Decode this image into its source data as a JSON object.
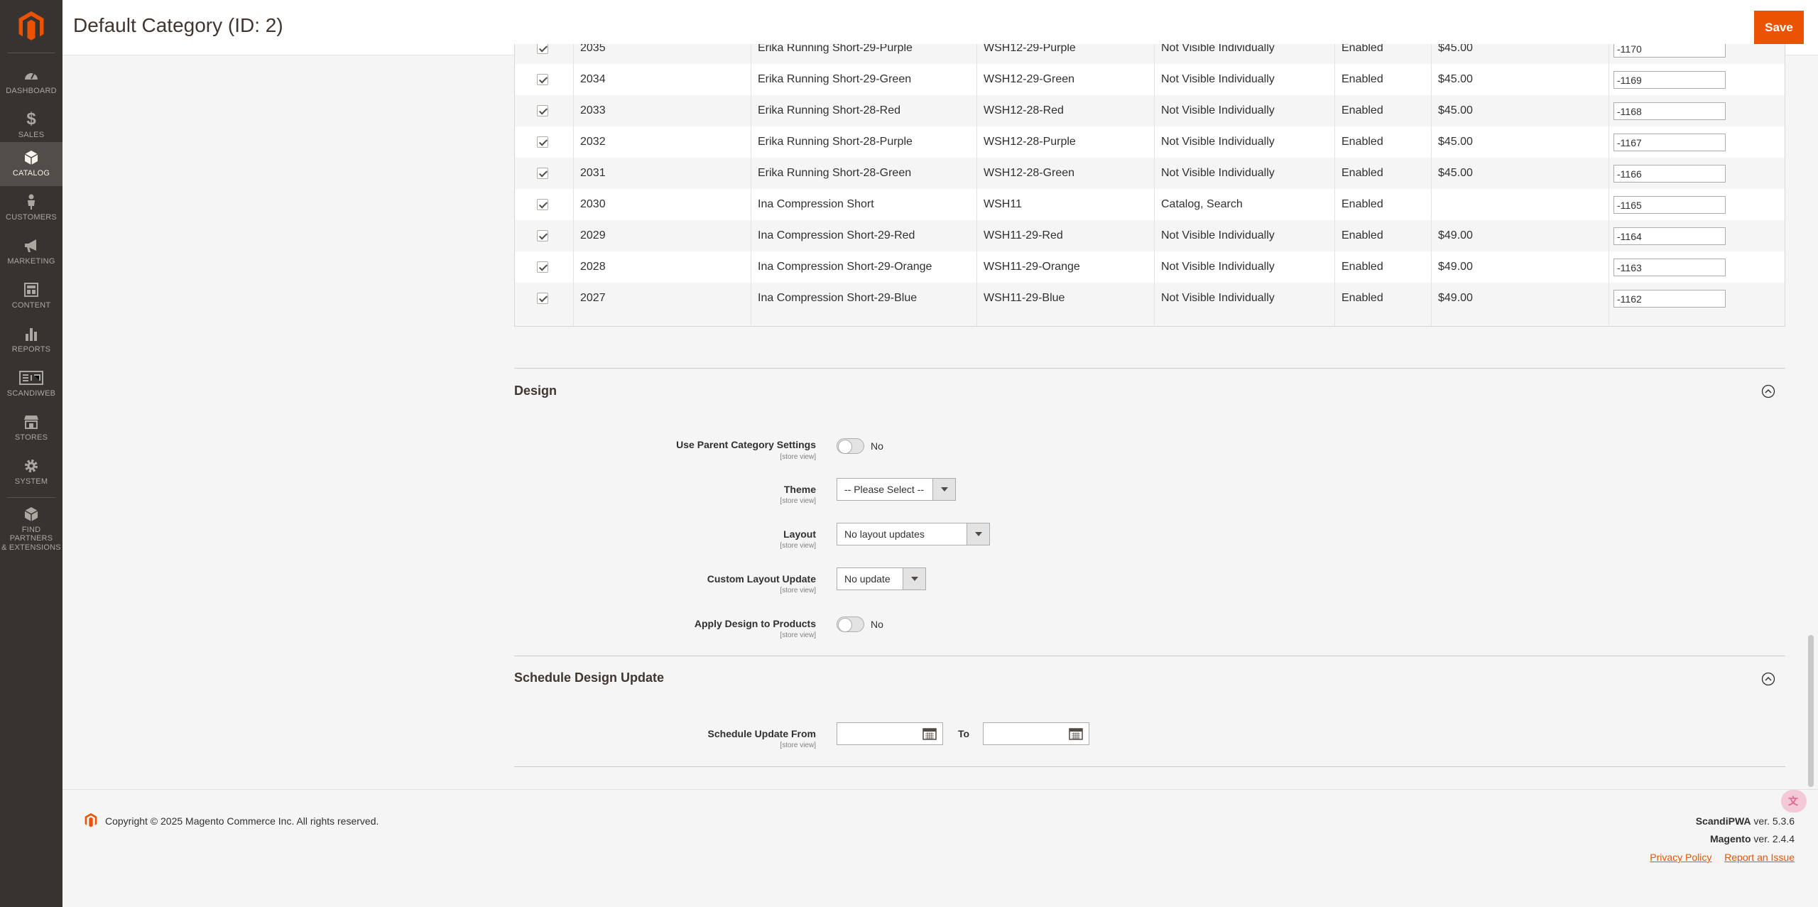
{
  "header": {
    "title": "Default Category (ID: 2)",
    "save_label": "Save"
  },
  "sidebar": {
    "items": [
      {
        "label": "DASHBOARD",
        "icon": "dashboard-icon"
      },
      {
        "label": "SALES",
        "icon": "dollar-icon"
      },
      {
        "label": "CATALOG",
        "icon": "box-icon",
        "active": true
      },
      {
        "label": "CUSTOMERS",
        "icon": "person-icon"
      },
      {
        "label": "MARKETING",
        "icon": "megaphone-icon"
      },
      {
        "label": "CONTENT",
        "icon": "layout-icon"
      },
      {
        "label": "REPORTS",
        "icon": "bar-chart-icon"
      },
      {
        "label": "SCANDIWEB",
        "icon": "scandiweb-icon"
      },
      {
        "label": "STORES",
        "icon": "store-icon"
      },
      {
        "label": "SYSTEM",
        "icon": "gear-icon"
      }
    ],
    "partners": {
      "line1": "FIND PARTNERS",
      "line2": "& EXTENSIONS"
    }
  },
  "grid": {
    "rows": [
      {
        "id": "2035",
        "name": "Erika Running Short-29-Purple",
        "sku": "WSH12-29-Purple",
        "visibility": "Not Visible Individually",
        "status": "Enabled",
        "price": "$45.00",
        "position": "-1170"
      },
      {
        "id": "2034",
        "name": "Erika Running Short-29-Green",
        "sku": "WSH12-29-Green",
        "visibility": "Not Visible Individually",
        "status": "Enabled",
        "price": "$45.00",
        "position": "-1169"
      },
      {
        "id": "2033",
        "name": "Erika Running Short-28-Red",
        "sku": "WSH12-28-Red",
        "visibility": "Not Visible Individually",
        "status": "Enabled",
        "price": "$45.00",
        "position": "-1168"
      },
      {
        "id": "2032",
        "name": "Erika Running Short-28-Purple",
        "sku": "WSH12-28-Purple",
        "visibility": "Not Visible Individually",
        "status": "Enabled",
        "price": "$45.00",
        "position": "-1167"
      },
      {
        "id": "2031",
        "name": "Erika Running Short-28-Green",
        "sku": "WSH12-28-Green",
        "visibility": "Not Visible Individually",
        "status": "Enabled",
        "price": "$45.00",
        "position": "-1166"
      },
      {
        "id": "2030",
        "name": "Ina Compression Short",
        "sku": "WSH11",
        "visibility": "Catalog, Search",
        "status": "Enabled",
        "price": "",
        "position": "-1165"
      },
      {
        "id": "2029",
        "name": "Ina Compression Short-29-Red",
        "sku": "WSH11-29-Red",
        "visibility": "Not Visible Individually",
        "status": "Enabled",
        "price": "$49.00",
        "position": "-1164"
      },
      {
        "id": "2028",
        "name": "Ina Compression Short-29-Orange",
        "sku": "WSH11-29-Orange",
        "visibility": "Not Visible Individually",
        "status": "Enabled",
        "price": "$49.00",
        "position": "-1163"
      },
      {
        "id": "2027",
        "name": "Ina Compression Short-29-Blue",
        "sku": "WSH11-29-Blue",
        "visibility": "Not Visible Individually",
        "status": "Enabled",
        "price": "$49.00",
        "position": "-1162"
      }
    ]
  },
  "design": {
    "title": "Design",
    "scope": "[store view]",
    "use_parent": {
      "label": "Use Parent Category Settings",
      "value": "No"
    },
    "theme": {
      "label": "Theme",
      "value": "-- Please Select --"
    },
    "layout": {
      "label": "Layout",
      "value": "No layout updates"
    },
    "custom_layout": {
      "label": "Custom Layout Update",
      "value": "No update"
    },
    "apply_design": {
      "label": "Apply Design to Products",
      "value": "No"
    }
  },
  "schedule": {
    "title": "Schedule Design Update",
    "from_label": "Schedule Update From",
    "to_label": "To",
    "scope": "[store view]"
  },
  "footer": {
    "copyright": "Copyright © 2025 Magento Commerce Inc. All rights reserved.",
    "scandipwa_name": "ScandiPWA",
    "scandipwa_ver": " ver. 5.3.6",
    "magento_name": "Magento",
    "magento_ver": " ver. 2.4.4",
    "privacy": "Privacy Policy",
    "report": "Report an Issue"
  },
  "colors": {
    "accent": "#eb5202",
    "sidebar": "#373330"
  }
}
